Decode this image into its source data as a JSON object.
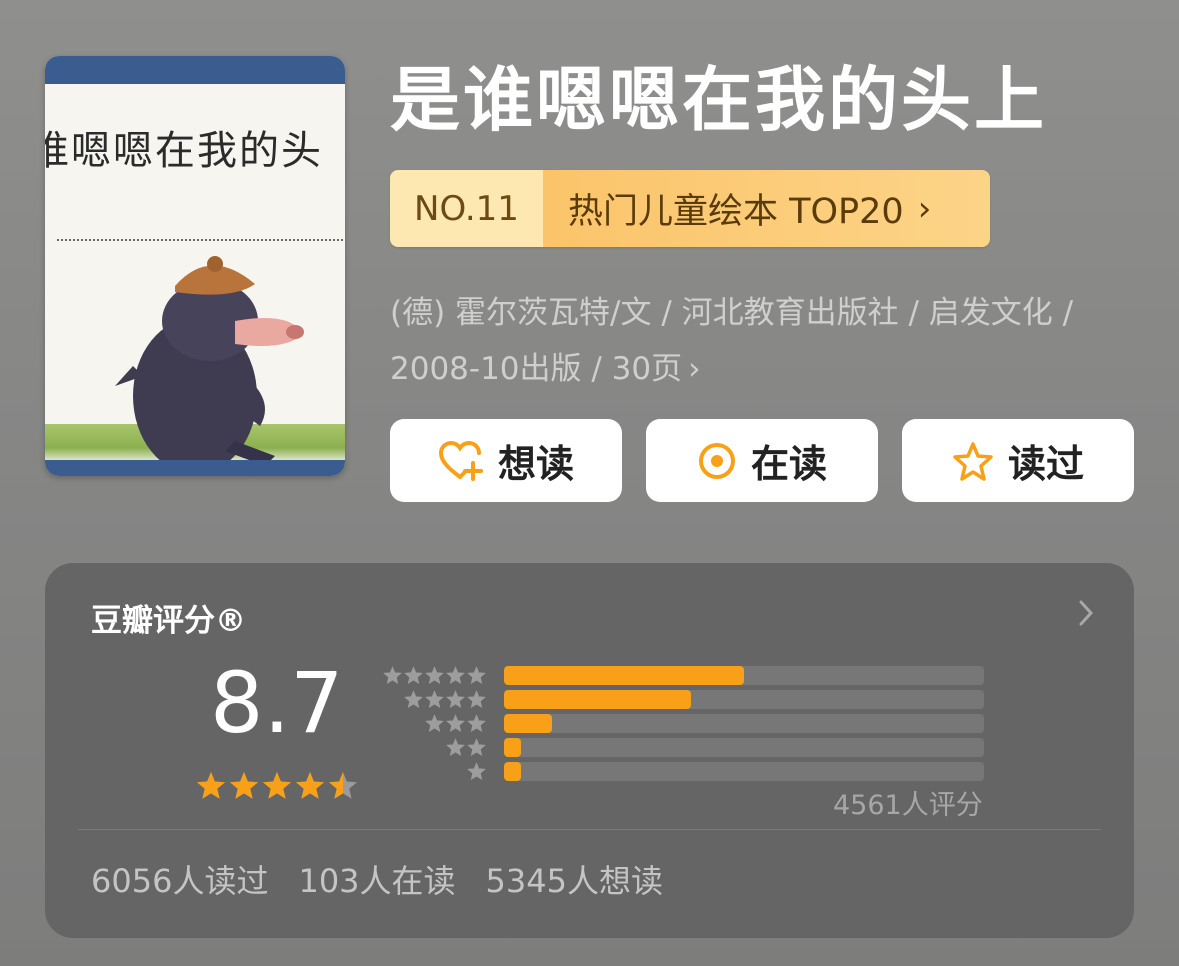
{
  "book": {
    "title": "是谁嗯嗯在我的头上",
    "cover": {
      "title_text": "是谁嗯嗯在我的头上"
    }
  },
  "rank": {
    "number": "NO.11",
    "list_name": "热门儿童绘本 TOP20",
    "chevron": "›",
    "colors": {
      "number_bg": "#fde8b2",
      "list_bg": "#fbc46a"
    }
  },
  "meta": {
    "line1": "(德) 霍尔茨瓦特/文 / 河北教育出版社 / 启发文化 /",
    "line2": "2008-10出版 / 30页",
    "chevron": "›"
  },
  "actions": {
    "want": {
      "label": "想读",
      "icon": "heart-plus-icon"
    },
    "reading": {
      "label": "在读",
      "icon": "target-icon"
    },
    "read": {
      "label": "读过",
      "icon": "star-outline-icon"
    },
    "accent": "#f8a018"
  },
  "rating": {
    "header": "豆瓣评分®",
    "score": "8.7",
    "stars": 4.5,
    "distribution": [
      {
        "stars": 5,
        "fraction": 0.5
      },
      {
        "stars": 4,
        "fraction": 0.39
      },
      {
        "stars": 3,
        "fraction": 0.1
      },
      {
        "stars": 2,
        "fraction": 0.035
      },
      {
        "stars": 1,
        "fraction": 0.035
      }
    ],
    "count_text": "4561人评分",
    "bar_color": "#f8a018"
  },
  "stats": {
    "read": "6056人读过",
    "reading": "103人在读",
    "want": "5345人想读"
  }
}
